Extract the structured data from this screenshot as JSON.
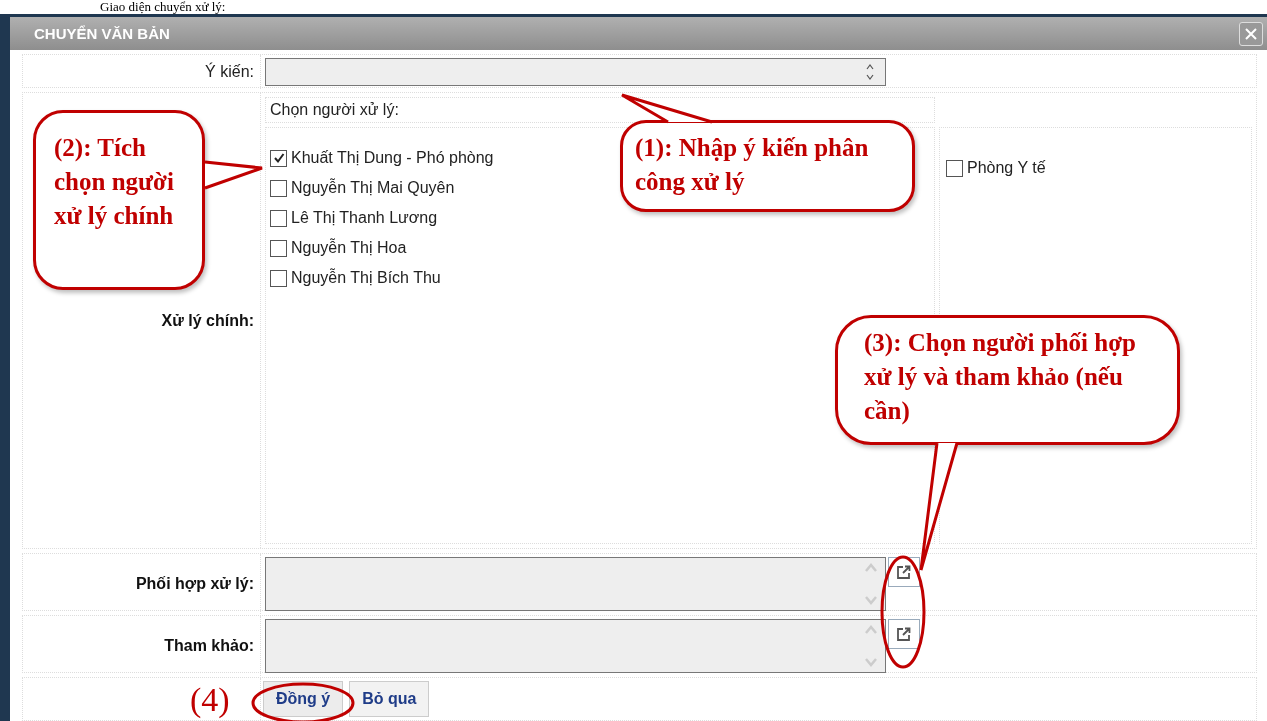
{
  "caption": "Giao diện chuyển xử lý:",
  "dialog": {
    "title": "CHUYỂN VĂN BẢN"
  },
  "opinion": {
    "label": "Ý kiến:"
  },
  "handlers": {
    "heading": "Chọn người xử lý:",
    "label": "Xử lý chính:",
    "people": [
      {
        "name": "Khuất Thị Dung - Phó phòng",
        "checked": true
      },
      {
        "name": "Nguyễn Thị Mai Quyên",
        "checked": false
      },
      {
        "name": "Lê Thị Thanh Lương",
        "checked": false
      },
      {
        "name": "Nguyễn Thị Hoa",
        "checked": false
      },
      {
        "name": "Nguyễn Thị Bích Thu",
        "checked": false
      }
    ],
    "departments": [
      {
        "name": "Phòng Y tế",
        "checked": false
      }
    ]
  },
  "pickers": [
    {
      "label": "Phối hợp xử lý:"
    },
    {
      "label": "Tham khảo:"
    }
  ],
  "buttons": [
    {
      "label": "Đồng ý",
      "kind": "primary"
    },
    {
      "label": "Bỏ qua",
      "kind": "cancel"
    }
  ],
  "annotations": [
    {
      "kind": "callout",
      "text": "(2): Tích chọn người xử lý chính"
    },
    {
      "kind": "callout",
      "text": "(1): Nhập ý kiến phân công xử lý"
    },
    {
      "kind": "callout",
      "text": "(3): Chọn người phối hợp xử lý và tham khảo (nếu cần)"
    },
    {
      "kind": "step",
      "text": "(4)"
    }
  ]
}
